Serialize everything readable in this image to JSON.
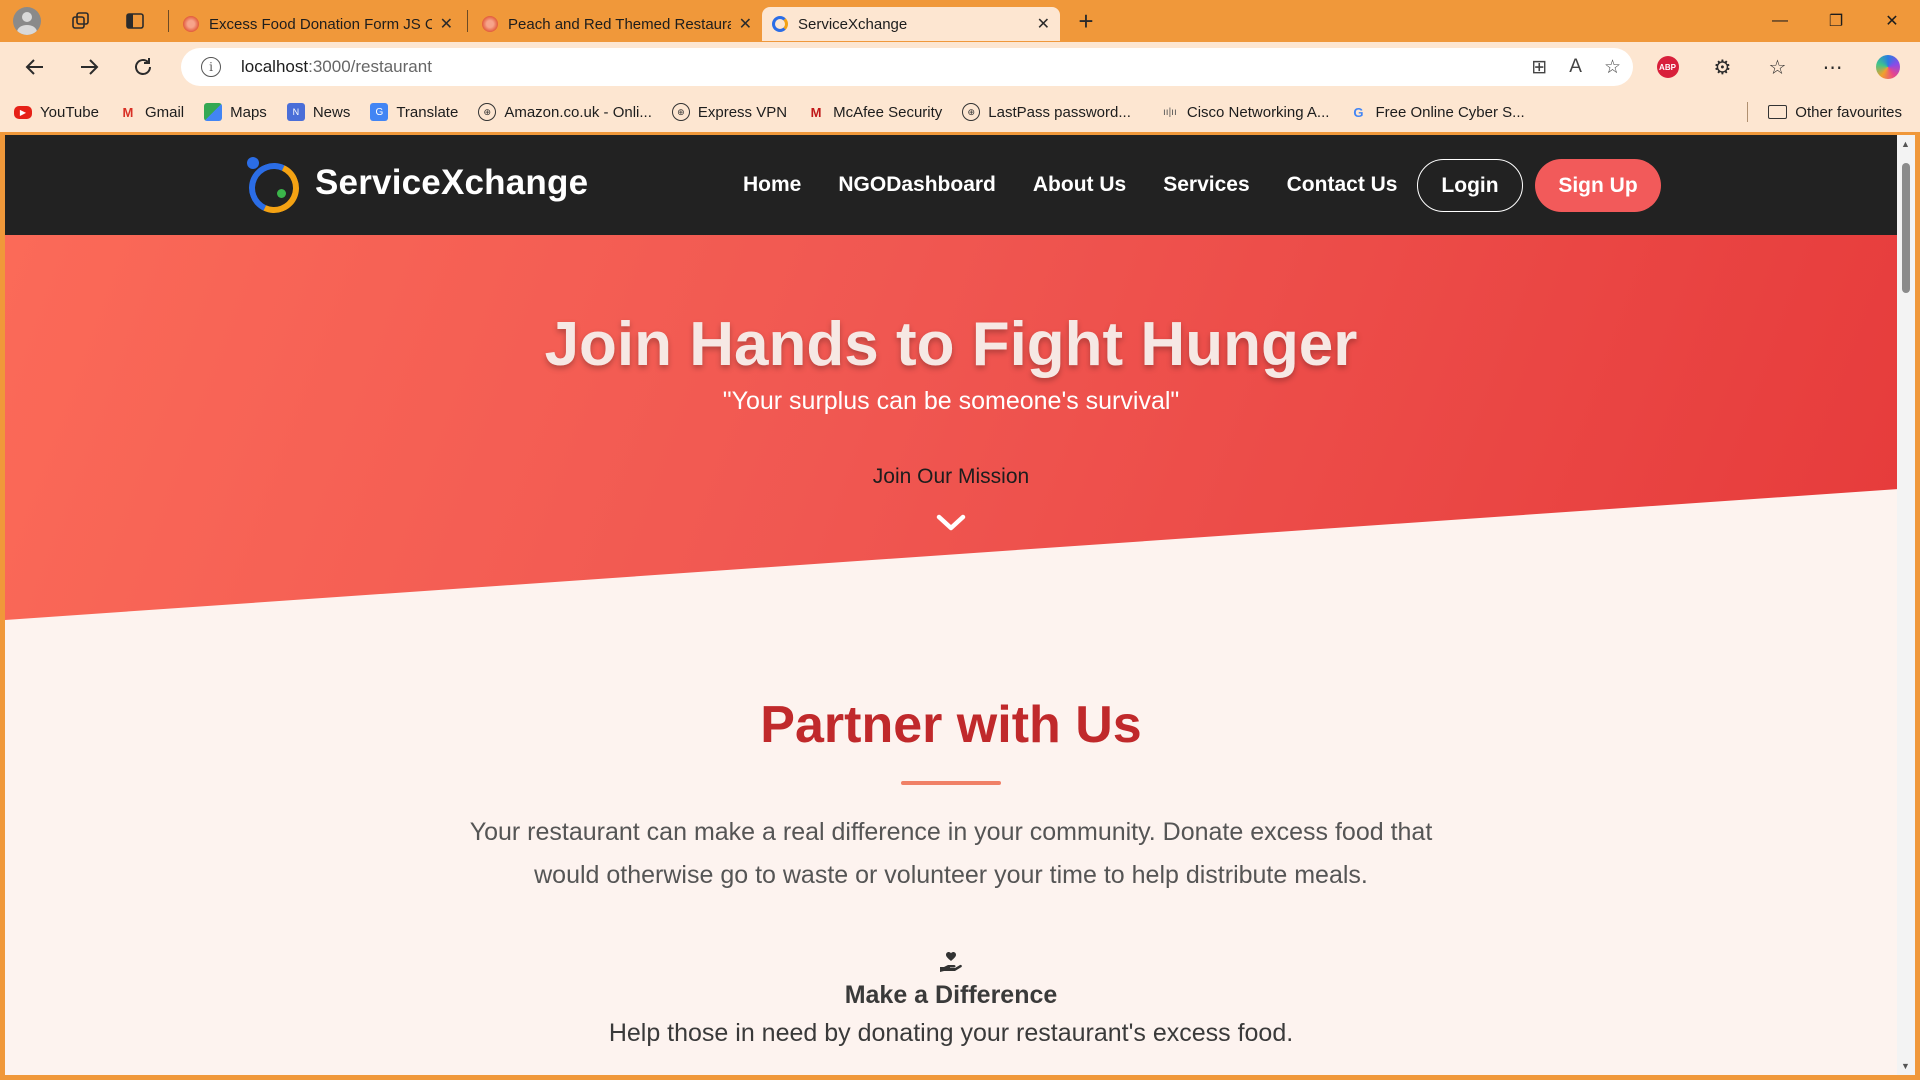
{
  "browser": {
    "tabs": [
      {
        "title": "Excess Food Donation Form JS Co",
        "active": false
      },
      {
        "title": "Peach and Red Themed Restaurar",
        "active": false
      },
      {
        "title": "ServiceXchange",
        "active": true
      }
    ],
    "address": {
      "host": "localhost",
      "path": ":3000/restaurant"
    },
    "bookmarks": [
      {
        "label": "YouTube",
        "icon": "youtube-icon"
      },
      {
        "label": "Gmail",
        "icon": "gmail-icon"
      },
      {
        "label": "Maps",
        "icon": "maps-icon"
      },
      {
        "label": "News",
        "icon": "news-icon"
      },
      {
        "label": "Translate",
        "icon": "translate-icon"
      },
      {
        "label": "Amazon.co.uk - Onli...",
        "icon": "globe-icon"
      },
      {
        "label": "Express VPN",
        "icon": "globe-icon"
      },
      {
        "label": "McAfee Security",
        "icon": "mcafee-icon"
      },
      {
        "label": "LastPass password...",
        "icon": "globe-icon"
      },
      {
        "label": "Cisco Networking A...",
        "icon": "cisco-icon"
      },
      {
        "label": "Free Online Cyber S...",
        "icon": "google-icon"
      }
    ],
    "other_favourites": "Other favourites",
    "frame_color": "#f0983a",
    "toolbar_color": "#fde6d1"
  },
  "site": {
    "brand": "ServiceXchange",
    "nav": [
      "Home",
      "NGODashboard",
      "About Us",
      "Services",
      "Contact Us"
    ],
    "login": "Login",
    "signup": "Sign Up",
    "accent": "#f25a5a",
    "nav_bg": "#222222"
  },
  "hero": {
    "title": "Join Hands to Fight Hunger",
    "quote": "\"Your surplus can be someone's survival\"",
    "cta": "Join Our Mission",
    "icon": "chevron-down-icon"
  },
  "partner": {
    "title": "Partner with Us",
    "description": "Your restaurant can make a real difference in your community. Donate excess food that would otherwise go to waste or volunteer your time to help distribute meals.",
    "feature_icon": "hand-holding-heart-icon",
    "feature_title": "Make a Difference",
    "feature_text": "Help those in need by donating your restaurant's excess food."
  }
}
